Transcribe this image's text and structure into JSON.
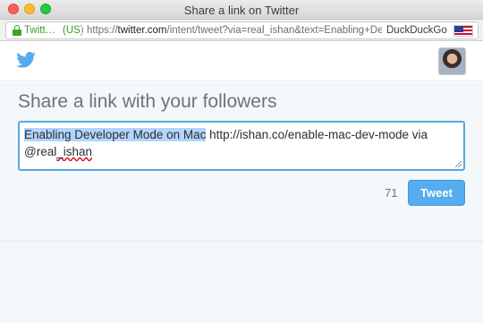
{
  "window": {
    "title": "Share a link on Twitter"
  },
  "address_bar": {
    "identity": "Twitt…",
    "region": "(US)",
    "url_prefix": "https://",
    "url_host": "twitter.com",
    "url_path": "/intent/tweet?via=real_ishan&text=Enabling+Deve",
    "search_engine": "DuckDuckGo",
    "flag": "us-flag-icon"
  },
  "header": {
    "logo": "twitter-bird-icon",
    "avatar": "user-avatar"
  },
  "main": {
    "heading": "Share a link with your followers",
    "tweet_text": {
      "selected": "Enabling Developer Mode on Mac",
      "rest": " http://ishan.co/enable-mac-dev-mode via ",
      "mention_prefix": "@real",
      "mention_misspelled": "_ishan"
    },
    "char_count": "71",
    "tweet_button_label": "Tweet"
  },
  "colors": {
    "twitter_blue": "#55acee",
    "heading_gray": "#66757f",
    "secure_green": "#3f9b24",
    "background": "#f5f8fa"
  }
}
